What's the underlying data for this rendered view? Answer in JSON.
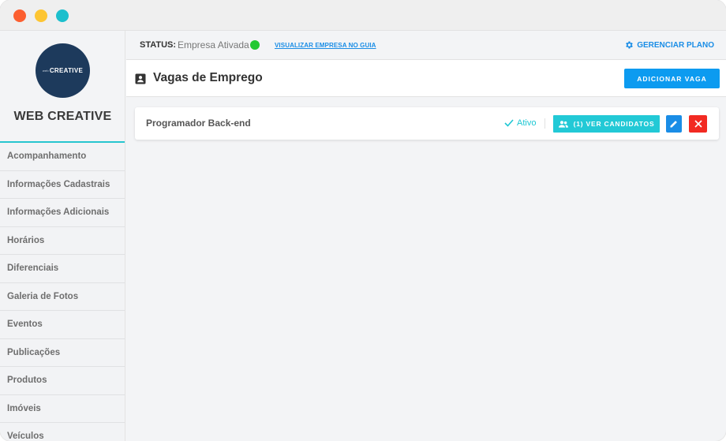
{
  "window": {
    "controls": [
      "close",
      "minimize",
      "maximize"
    ]
  },
  "sidebar": {
    "logo": {
      "small_text": "web",
      "big_text": "CREATIVE"
    },
    "company_name": "WEB CREATIVE",
    "items": [
      {
        "label": "Acompanhamento"
      },
      {
        "label": "Informações Cadastrais"
      },
      {
        "label": "Informações Adicionais"
      },
      {
        "label": "Horários"
      },
      {
        "label": "Diferenciais"
      },
      {
        "label": "Galeria de Fotos"
      },
      {
        "label": "Eventos"
      },
      {
        "label": "Publicações"
      },
      {
        "label": "Produtos"
      },
      {
        "label": "Imóveis"
      },
      {
        "label": "Veículos"
      }
    ]
  },
  "statusbar": {
    "status_label": "STATUS:",
    "status_value": "Empresa Ativada",
    "status_color": "#22c832",
    "guide_link": "VISUALIZAR EMPRESA NO GUIA",
    "manage_plan": "GERENCIAR PLANO",
    "manage_plan_icon": "gear-icon"
  },
  "page": {
    "title": "Vagas de Emprego",
    "title_icon": "contact-card-icon",
    "add_button": "ADICIONAR VAGA"
  },
  "jobs": [
    {
      "title": "Programador Back-end",
      "status": "Ativo",
      "candidates_label": "(1) VER CANDIDATOS",
      "edit_icon": "pencil-icon",
      "delete_icon": "close-icon"
    }
  ],
  "colors": {
    "accent": "#1a8de6",
    "teal": "#22c9d6",
    "danger": "#f22a22",
    "sidebar_accent": "#27c5cf"
  }
}
